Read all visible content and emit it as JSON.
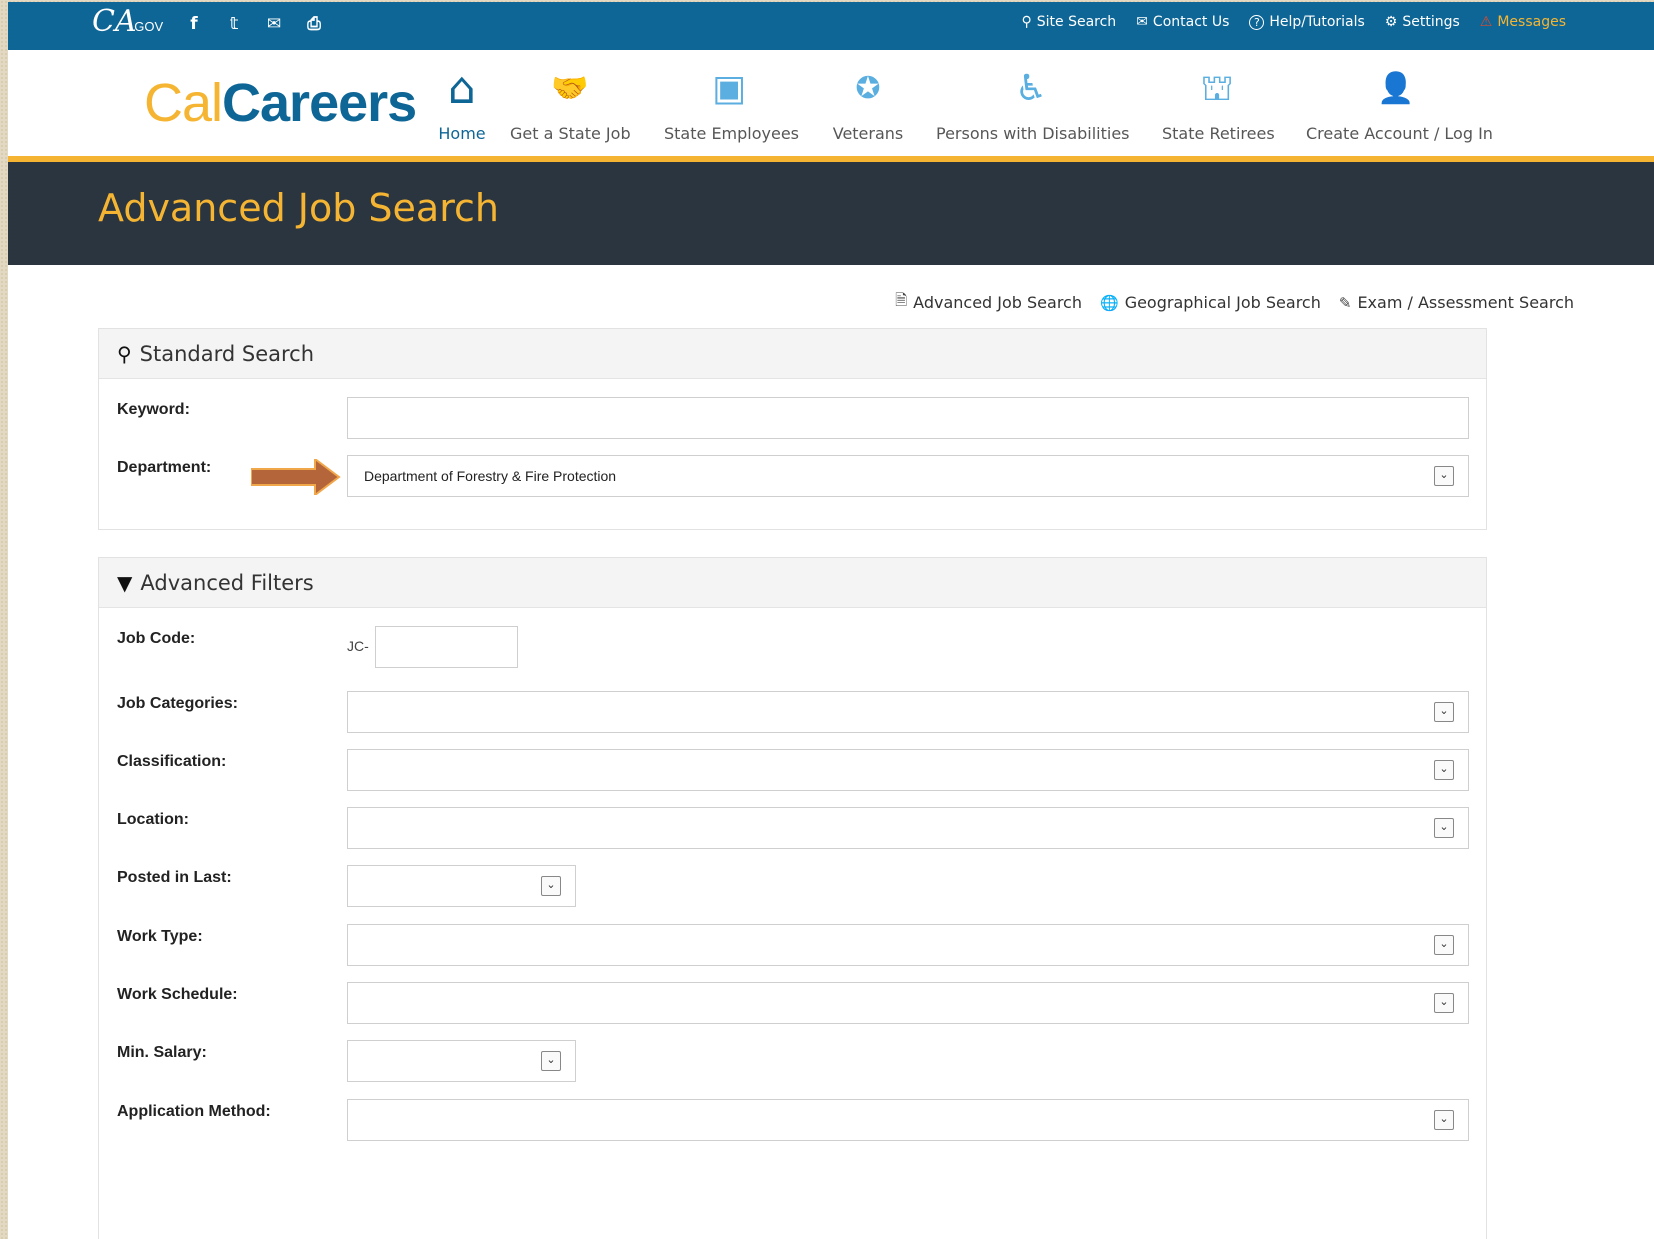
{
  "utility": {
    "logo_text": "CA",
    "logo_suffix": ".GOV",
    "social": [
      "f",
      "𝕥",
      "✉",
      "⎙"
    ],
    "links": [
      {
        "icon": "search-icon",
        "glyph": "⚲",
        "label": "Site Search"
      },
      {
        "icon": "envelope-icon",
        "glyph": "✉",
        "label": "Contact Us"
      },
      {
        "icon": "help-icon",
        "glyph": "?",
        "label": "Help/Tutorials"
      },
      {
        "icon": "gear-icon",
        "glyph": "⚙",
        "label": "Settings"
      },
      {
        "icon": "warning-icon",
        "glyph": "⚠",
        "label": "Messages"
      }
    ]
  },
  "brand": {
    "cal": "Cal",
    "careers": "Careers"
  },
  "nav": [
    {
      "icon": "home-icon",
      "glyph": "⌂",
      "label": "Home",
      "active": true
    },
    {
      "icon": "handshake-icon",
      "glyph": "🤝",
      "label": "Get a State Job"
    },
    {
      "icon": "badge-icon",
      "glyph": "▣",
      "label": "State Employees"
    },
    {
      "icon": "star-icon",
      "glyph": "✪",
      "label": "Veterans"
    },
    {
      "icon": "wheelchair-icon",
      "glyph": "♿",
      "label": "Persons with Disabilities"
    },
    {
      "icon": "capitol-icon",
      "glyph": "⛫",
      "label": "State Retirees"
    },
    {
      "icon": "user-icon",
      "glyph": "👤",
      "label": "Create Account / Log In"
    }
  ],
  "page_title": "Advanced Job Search",
  "search_links": [
    {
      "icon": "document-icon",
      "glyph": "🗎",
      "label": "Advanced Job Search"
    },
    {
      "icon": "globe-icon",
      "glyph": "🌐",
      "label": "Geographical Job Search"
    },
    {
      "icon": "pencil-icon",
      "glyph": "✎",
      "label": "Exam / Assessment Search"
    }
  ],
  "standard": {
    "title": "Standard Search",
    "keyword_label": "Keyword:",
    "keyword_value": "",
    "department_label": "Department:",
    "department_value": "Department of Forestry & Fire Protection"
  },
  "advanced": {
    "title": "Advanced Filters",
    "job_code_label": "Job Code:",
    "job_code_prefix": "JC-",
    "job_categories_label": "Job Categories:",
    "classification_label": "Classification:",
    "location_label": "Location:",
    "posted_label": "Posted in Last:",
    "work_type_label": "Work Type:",
    "work_schedule_label": "Work Schedule:",
    "min_salary_label": "Min. Salary:",
    "application_method_label": "Application Method:"
  },
  "colors": {
    "brand_blue": "#0e6696",
    "gold": "#f5b532",
    "title_band": "#2a3540",
    "arrow": "#b5653a"
  }
}
